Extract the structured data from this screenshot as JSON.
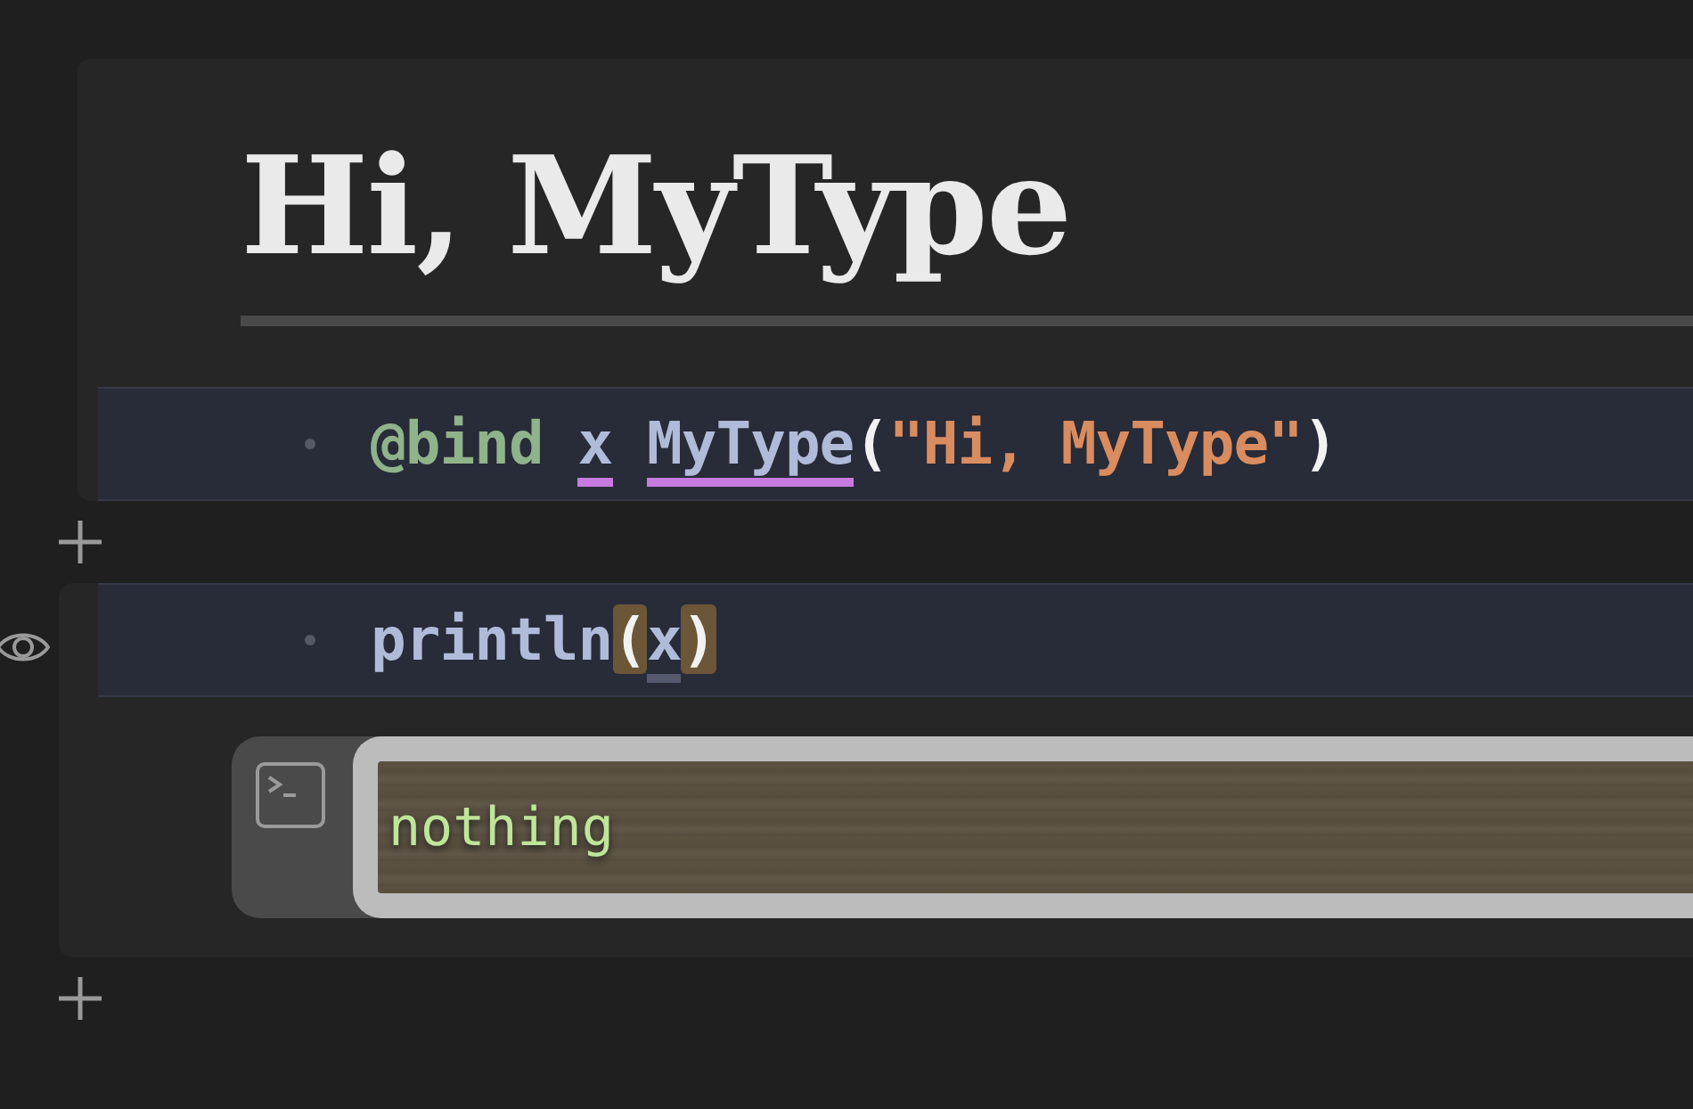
{
  "cells": [
    {
      "output": {
        "kind": "heading",
        "text": "Hi, MyType"
      },
      "code": [
        {
          "text": "@bind",
          "kind": "macro",
          "space_before": false
        },
        {
          "text": "x",
          "kind": "bound",
          "space_before": true
        },
        {
          "text": "MyType",
          "kind": "bound",
          "space_before": true
        },
        {
          "text": "(",
          "kind": "punct",
          "space_before": false
        },
        {
          "text": "\"Hi, MyType\"",
          "kind": "string",
          "space_before": false
        },
        {
          "text": ")",
          "kind": "punct",
          "space_before": false
        }
      ],
      "show_eye": false
    },
    {
      "output": {
        "kind": "terminal",
        "text": "nothing"
      },
      "code": [
        {
          "text": "println",
          "kind": "plain",
          "space_before": false
        },
        {
          "text": "(",
          "kind": "match",
          "space_before": false
        },
        {
          "text": "x",
          "kind": "cursor",
          "space_before": false
        },
        {
          "text": ")",
          "kind": "match",
          "space_before": false
        }
      ],
      "show_eye": true
    }
  ]
}
